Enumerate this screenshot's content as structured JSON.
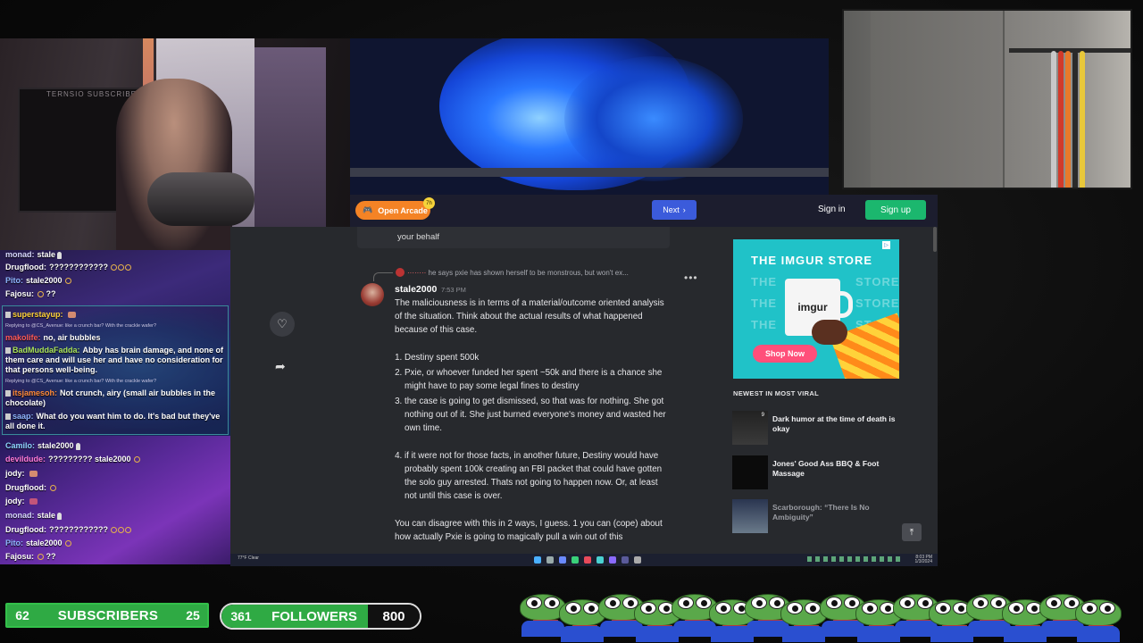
{
  "webcam": {
    "monitor_text": "TERNSIO SUBSCRIBED"
  },
  "browser": {
    "arcade_label": "Open Arcade",
    "arcade_badge": "7h",
    "next_label": "Next",
    "signin_label": "Sign in",
    "signup_label": "Sign up"
  },
  "comments": {
    "previous_tail": "your behalf",
    "reply_preview": "he says pxie has shown herself to be monstrous, but won't ex...",
    "username": "stale2000",
    "time": "7:53 PM",
    "more": "•••",
    "paragraph1": "The maliciousness is in terms of a material/outcome oriented analysis of the situation.  Think about the actual results of what happened because of this case.",
    "list1": [
      "Destiny spent 500k",
      "Pxie, or whoever funded her spent ~50k and there is a chance she might have to pay some legal fines to destiny",
      "the case is going to get dismissed, so that was for nothing.  She got nothing out of it.  She just burned everyone's money and wasted her own time."
    ],
    "list2_item": "if it were not for those facts, in another future, Destiny would have probably spent 100k  creating an FBI packet that could have gotten the solo guy arrested.  Thats not going to happen now.  Or, at least not until this case is over.",
    "paragraph2": "You can disagree with this in 2 ways, I guess. 1 you can (cope) about how actually Pxie is going to magically pull a win out of this"
  },
  "sidebar": {
    "ad_title": "THE IMGUR STORE",
    "ad_ghost": [
      "THE",
      "STORE",
      "THE",
      "STORE",
      "THE",
      "STORE"
    ],
    "mug_label": "imgur",
    "ad_button": "Shop Now",
    "viral_heading": "NEWEST IN MOST VIRAL",
    "viral": [
      {
        "title": "Dark humor at the time of death is okay",
        "thumb_badge": "9"
      },
      {
        "title": "Jones' Good Ass BBQ & Foot Massage"
      },
      {
        "title": "Scarborough: “There Is No Ambiguity”"
      }
    ]
  },
  "chat": [
    {
      "name": "monad:",
      "text": "stale",
      "color": "#d9d9ff"
    },
    {
      "name": "Drugflood:",
      "text": "????????????",
      "color": "#ffffff"
    },
    {
      "name": "Pito:",
      "text": "stale2000",
      "color": "#8fb6ff"
    },
    {
      "name": "Fajosu:",
      "text": "??",
      "color": "#ffffff"
    },
    {
      "name": "superstayup:",
      "text": "",
      "color": "#ffd23a"
    },
    {
      "hint": "Replying to @CS_Avenue: like a crunch bar? With the crackle wafer?"
    },
    {
      "name": "makolife:",
      "text": "no, air bubbles",
      "color": "#ff5a5a"
    },
    {
      "name": "BadMuddaFadda:",
      "text": "Abby has brain damage, and none of them care and will use her and have no consideration for that persons well-being.",
      "color": "#a9e35a"
    },
    {
      "hint": "Replying to @CS_Avenue: like a crunch bar? With the crackle wafer?"
    },
    {
      "name": "itsjamesoh:",
      "text": "Not crunch, airy (small air bubbles in the chocolate)",
      "color": "#ff8a3a"
    },
    {
      "name": "saap:",
      "text": "What do you want him to do. It's bad but they've all done it.",
      "color": "#8fb6ff"
    }
  ],
  "chat2": [
    {
      "name": "Camilo:",
      "text": "stale2000",
      "color": "#8fd6ff"
    },
    {
      "name": "devildude:",
      "text": "????????? stale2000",
      "color": "#ff7ad9"
    },
    {
      "name": "jody:",
      "text": "",
      "color": "#ffffff"
    },
    {
      "name": "Drugflood:",
      "text": "",
      "color": "#ffffff"
    },
    {
      "name": "jody:",
      "text": "",
      "color": "#ffffff"
    },
    {
      "name": "monad:",
      "text": "stale",
      "color": "#d9d9ff"
    },
    {
      "name": "Drugflood:",
      "text": "????????????",
      "color": "#ffffff"
    },
    {
      "name": "Pito:",
      "text": "stale2000",
      "color": "#8fb6ff"
    },
    {
      "name": "Fajosu:",
      "text": "??",
      "color": "#ffffff"
    }
  ],
  "stats": {
    "subs_left": "62",
    "subs_label": "SUBSCRIBERS",
    "subs_right": "25",
    "followers_left": "361",
    "followers_label": "FOLLOWERS",
    "followers_right": "800"
  },
  "taskbar": {
    "weather": "77°F Clear",
    "clock_time": "8:03 PM",
    "clock_date": "1/3/2024"
  },
  "colors": {
    "imgur_bg": "#27292d",
    "signup": "#1bb76e",
    "next": "#3b5bdb",
    "arcade": "#f48325",
    "stat_green": "#2faa44"
  }
}
